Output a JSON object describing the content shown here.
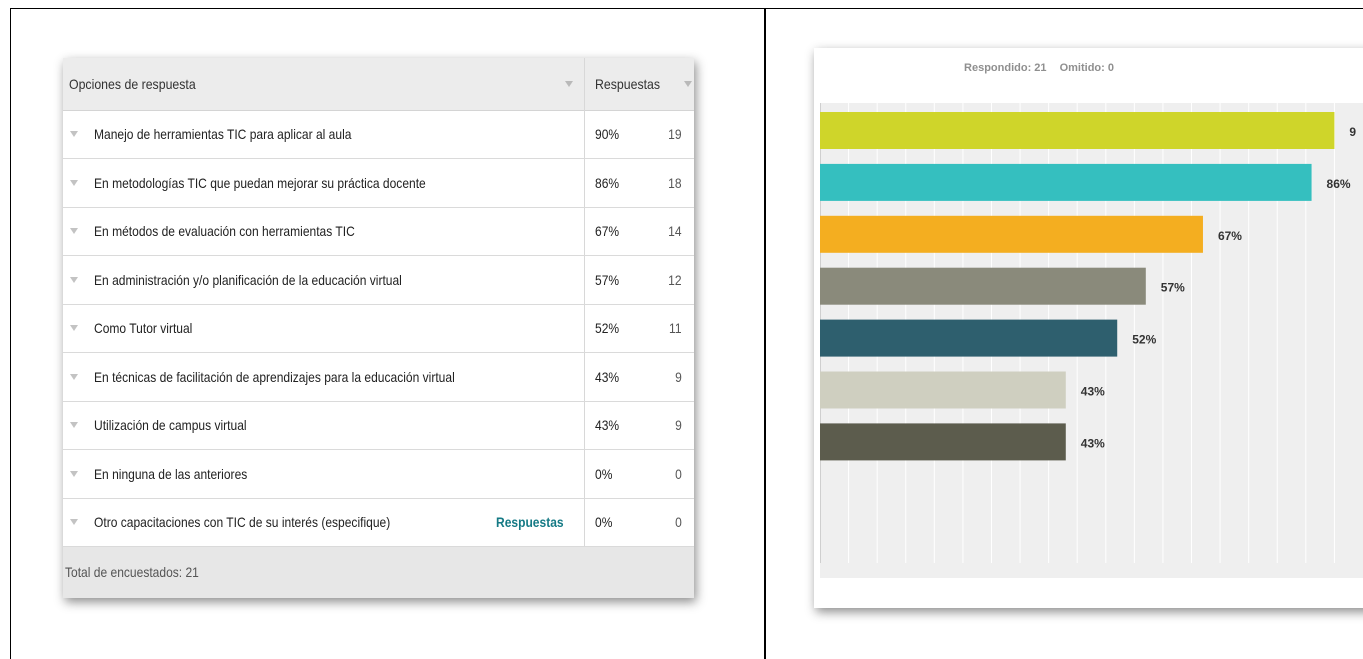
{
  "table": {
    "header_options": "Opciones de respuesta",
    "header_responses": "Respuestas",
    "rows": [
      {
        "label": "Manejo de herramientas TIC para aplicar al aula",
        "pct": "90%",
        "count": "19",
        "link": ""
      },
      {
        "label": "En metodologías TIC que puedan mejorar su práctica docente",
        "pct": "86%",
        "count": "18",
        "link": ""
      },
      {
        "label": "En métodos de evaluación con herramientas TIC",
        "pct": "67%",
        "count": "14",
        "link": ""
      },
      {
        "label": "En administración y/o planificación de la educación virtual",
        "pct": "57%",
        "count": "12",
        "link": ""
      },
      {
        "label": "Como Tutor virtual",
        "pct": "52%",
        "count": "11",
        "link": ""
      },
      {
        "label": "En técnicas de facilitación de aprendizajes para la educación virtual",
        "pct": "43%",
        "count": "9",
        "link": ""
      },
      {
        "label": "Utilización de campus virtual",
        "pct": "43%",
        "count": "9",
        "link": ""
      },
      {
        "label": "En ninguna de las anteriores",
        "pct": "0%",
        "count": "0",
        "link": ""
      },
      {
        "label": "Otro capacitaciones con TIC de su interés (especifique)",
        "pct": "0%",
        "count": "0",
        "link": "Respuestas"
      }
    ],
    "footer": "Total de encuestados: 21"
  },
  "chart_header": {
    "answered": "Respondido: 21",
    "skipped": "Omitido: 0"
  },
  "chart_data": {
    "type": "bar",
    "orientation": "horizontal",
    "values": [
      90,
      86,
      67,
      57,
      52,
      43,
      43,
      0,
      0
    ],
    "labels": [
      "9",
      "86%",
      "67%",
      "57%",
      "52%",
      "43%",
      "43%",
      "",
      ""
    ],
    "colors": [
      "#cfd52a",
      "#35bfbf",
      "#f4ae20",
      "#8a8a7b",
      "#2e5f6e",
      "#cfcfc0",
      "#5c5c4d",
      "#efefef",
      "#efefef"
    ],
    "xticks": [
      "0%",
      "10%",
      "20%",
      "30%",
      "40%",
      "50%",
      "60%",
      "70%",
      "80%",
      "90%"
    ],
    "xlim": [
      0,
      95
    ],
    "grid": true
  }
}
